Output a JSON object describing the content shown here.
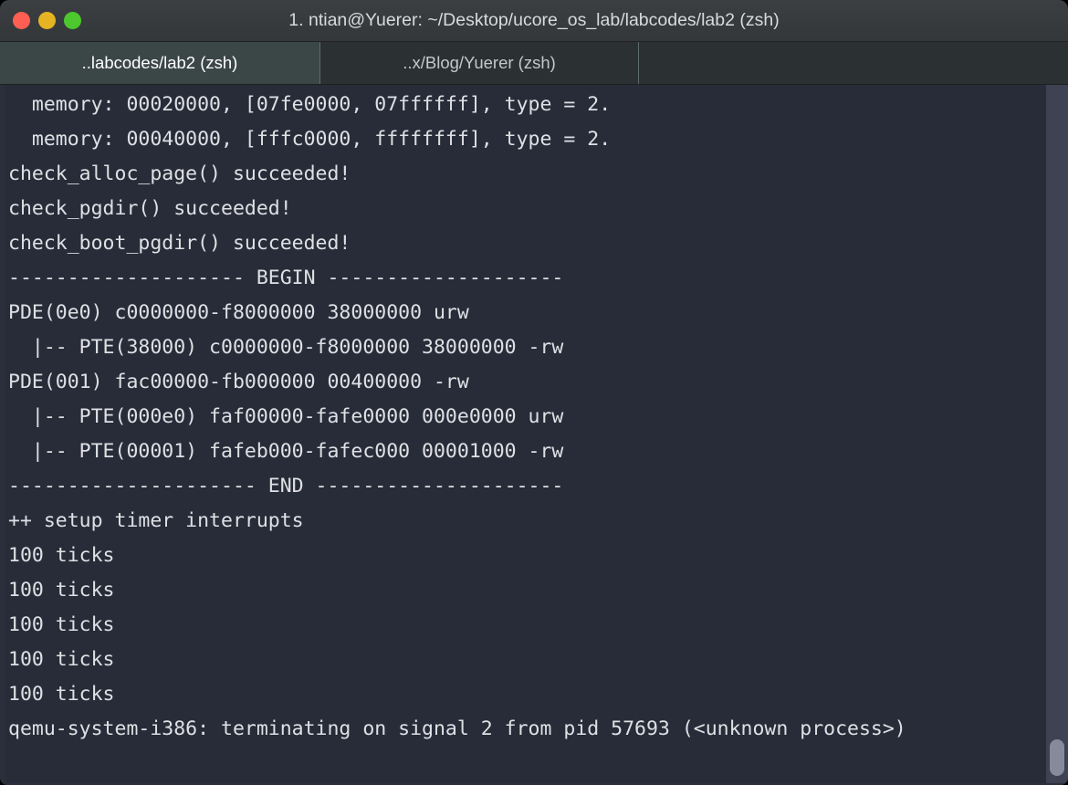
{
  "window": {
    "title": "1. ntian@Yuerer: ~/Desktop/ucore_os_lab/labcodes/lab2 (zsh)",
    "controls": {
      "close_label": "",
      "minimize_label": "",
      "zoom_label": ""
    },
    "colors": {
      "titlebar_bg": "#3a3d40",
      "close": "#ff5f52",
      "minimize": "#e6b422",
      "zoom": "#4cc82e",
      "terminal_bg": "#282c39",
      "terminal_fg": "#dfe0e4",
      "tab_active_bg": "#3b4647",
      "tab_inactive_bg": "#2b3133",
      "scrollbar_track": "#3e4252",
      "scrollbar_thumb": "#858b9a"
    }
  },
  "tabs": [
    {
      "label": "..labcodes/lab2 (zsh)",
      "active": true
    },
    {
      "label": "..x/Blog/Yuerer (zsh)",
      "active": false
    },
    {
      "label": "",
      "active": false
    }
  ],
  "terminal": {
    "lines": [
      "  memory: 00020000, [07fe0000, 07ffffff], type = 2.",
      "  memory: 00040000, [fffc0000, ffffffff], type = 2.",
      "check_alloc_page() succeeded!",
      "check_pgdir() succeeded!",
      "check_boot_pgdir() succeeded!",
      "-------------------- BEGIN --------------------",
      "PDE(0e0) c0000000-f8000000 38000000 urw",
      "  |-- PTE(38000) c0000000-f8000000 38000000 -rw",
      "PDE(001) fac00000-fb000000 00400000 -rw",
      "  |-- PTE(000e0) faf00000-fafe0000 000e0000 urw",
      "  |-- PTE(00001) fafeb000-fafec000 00001000 -rw",
      "--------------------- END ---------------------",
      "++ setup timer interrupts",
      "100 ticks",
      "100 ticks",
      "100 ticks",
      "100 ticks",
      "100 ticks",
      "qemu-system-i386: terminating on signal 2 from pid 57693 (<unknown process>)"
    ]
  },
  "scrollbar": {
    "position_label": "bottom"
  }
}
